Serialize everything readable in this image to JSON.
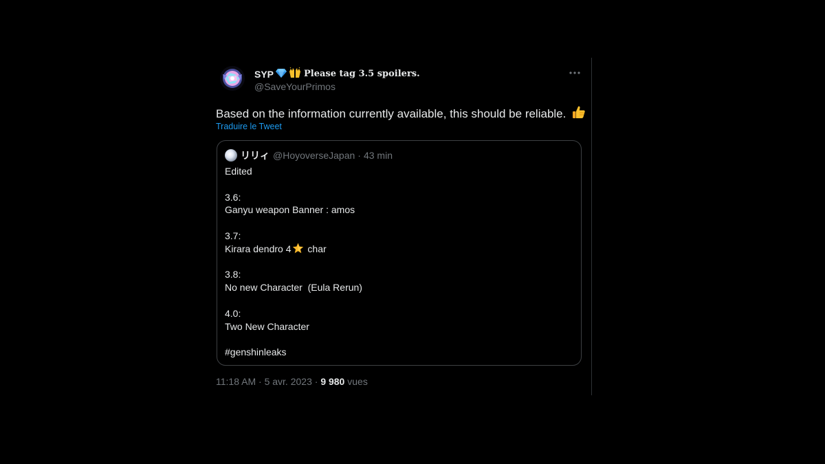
{
  "author": {
    "display_name": "SYP",
    "tagline": "Please tag 3.5 spoilers.",
    "handle": "@SaveYourPrimos",
    "emojis": [
      "gem-emoji",
      "raising-hands-emoji"
    ]
  },
  "tweet": {
    "text": "Based on the information currently available, this should be reliable.",
    "text_emoji": "thumbs-up-emoji",
    "translate_label": "Traduire le Tweet"
  },
  "quote": {
    "name": "リリィ",
    "handle": "@HoyoverseJapan",
    "separator": "·",
    "time": "43 min",
    "lines": {
      "l1": "Edited",
      "l3": "3.6:",
      "l4": "Ganyu weapon Banner : amos",
      "l6": "3.7:",
      "l7a": "Kirara dendro 4",
      "l7b": " char",
      "l9": "3.8:",
      "l10": "No new Character  (Eula Rerun)",
      "l12": "4.0:",
      "l13": "Two New Character",
      "l15": "#genshinleaks"
    },
    "star_emoji": "star-emoji"
  },
  "meta": {
    "time": "11:18 AM",
    "date": "5 avr. 2023",
    "separator": "·",
    "views_count": "9 980",
    "views_label": "vues"
  },
  "colors": {
    "background": "#000000",
    "text_primary": "#e7e9ea",
    "text_secondary": "#71767b",
    "link": "#1d9bf0",
    "border": "#3e4144"
  }
}
